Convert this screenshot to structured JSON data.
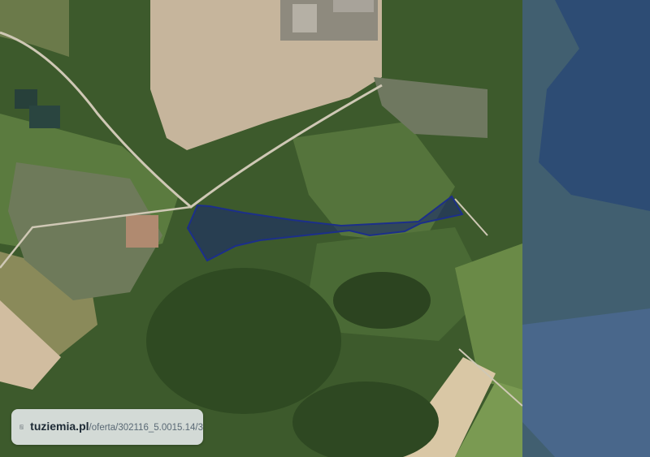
{
  "map": {
    "view": "satellite",
    "parcel_outline_color": "#1c2f8a",
    "parcel_fill_color": "#1b2b6b"
  },
  "badge": {
    "domain": "tuziemia.pl",
    "path": "/oferta/302116_5.0015.14/3",
    "icon": "topographic-contour-logo-icon"
  }
}
